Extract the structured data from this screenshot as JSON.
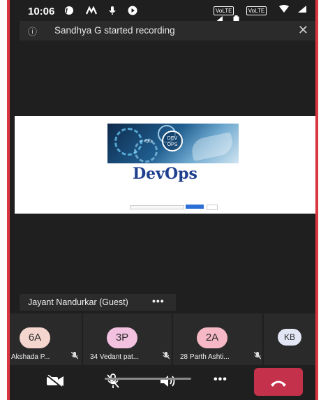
{
  "status_bar": {
    "time": "10:06",
    "left_icons": "❶ ⌃ ⚲ ●",
    "chip1": "VoLTE",
    "chip2": "VoLTE",
    "right_icons": "▼◢◢▮"
  },
  "banner": {
    "info_icon": "ⓘ",
    "text": "Sandhya G started recording",
    "close_icon": "✕"
  },
  "shared_screen": {
    "circle_text_top": "DEV",
    "circle_text_bottom": "OPS",
    "code_tag": "</>",
    "title": "DevOps"
  },
  "presenter": {
    "name": "Jayant Nandurkar (Guest)",
    "more": "•••"
  },
  "participants": [
    {
      "initials": "6A",
      "name": "Akshada P...",
      "color": "#f4d6cf"
    },
    {
      "initials": "3P",
      "name": "34 Vedant pat...",
      "color": "#f2c1e0"
    },
    {
      "initials": "2A",
      "name": "28 Parth Ashti...",
      "color": "#f5b8c4"
    },
    {
      "initials": "KB",
      "name": "",
      "color": "#e3e7f5"
    }
  ],
  "controls": {
    "camera_icon": "📷",
    "mic_icon": "🎙",
    "speaker_icon": "🔈",
    "more": "•••",
    "hangup_icon": "☎"
  },
  "colors": {
    "background": "#1f1f1f",
    "hangup": "#c4314b",
    "border": "#d9363e"
  }
}
